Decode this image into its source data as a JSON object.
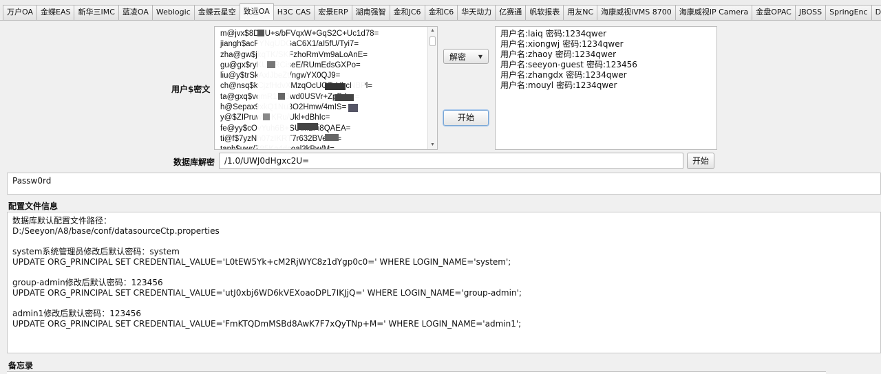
{
  "tabs": [
    {
      "label": "万户OA"
    },
    {
      "label": "金蝶EAS"
    },
    {
      "label": "新华三IMC"
    },
    {
      "label": "蓝凌OA"
    },
    {
      "label": "Weblogic"
    },
    {
      "label": "金蝶云星空"
    },
    {
      "label": "致远OA",
      "active": true
    },
    {
      "label": "H3C CAS"
    },
    {
      "label": "宏景ERP"
    },
    {
      "label": "湖南强智"
    },
    {
      "label": "金和JC6"
    },
    {
      "label": "金和C6"
    },
    {
      "label": "华天动力"
    },
    {
      "label": "亿赛通"
    },
    {
      "label": "帆软报表"
    },
    {
      "label": "用友NC"
    },
    {
      "label": "海康威视iVMS 8700"
    },
    {
      "label": "海康威视IP Camera"
    },
    {
      "label": "金盘OPAC"
    },
    {
      "label": "JBOSS"
    },
    {
      "label": "SpringEnc"
    },
    {
      "label": "Druid"
    }
  ],
  "decrypt": {
    "user_cipher_label": "用户$密文",
    "cipher_lines": [
      "m@jvx$8DNU+s/bFVqxW+GqS2C+Uc1d78=",
      "jiangh$acFYNgUDGaC6X1/aI5fU/Tyi7=",
      "zha@gw$jkqTK/SKFzhoRmVm9aLoAnE=",
      "gu@gx$ryKUmRCiseE/RUmEdsGXPo=",
      "liu@y$trSkAxlJbeZt/ngwYX0QJ9=",
      "ch@nsq$kCjzfHdvXMzqOcUGTeVLcNBPl=",
      "ta@gxq$vqmR1Ju3wd0USVr+ZpBdpk=",
      "h@Sepax9xkQ1Nu3O2Hmw/4mIS=",
      "y@$ZIPruwE1KRu/Ukl+dBhIc=",
      "fe@yy$cOvYuh6B+SUlm2Fi8QAEA=",
      "ti@f$7yzNh07zIKRT7r632BVeGx=",
      "tanh$uwr/Z85Ko4dsoal3kBw/M="
    ],
    "mode_select": "解密",
    "start_label": "开始",
    "results": [
      {
        "user": "用户名:laiq",
        "pwd": "密码:1234qwer"
      },
      {
        "user": "用户名:xiongwj",
        "pwd": "密码:1234qwer"
      },
      {
        "user": "用户名:zhaoy",
        "pwd": "密码:1234qwer"
      },
      {
        "user": "用户名:seeyon-guest",
        "pwd": "密码:123456"
      },
      {
        "user": "用户名:zhangdx",
        "pwd": "密码:1234qwer"
      },
      {
        "user": "用户名:mouyl",
        "pwd": "密码:1234qwer"
      }
    ]
  },
  "db_decrypt": {
    "label": "数据库解密",
    "input_value": "/1.0/UWJ0dHgxc2U=",
    "start_label": "开始",
    "output": "Passw0rd"
  },
  "config": {
    "title": "配置文件信息",
    "text": "数据库默认配置文件路径：\nD:/Seeyon/A8/base/conf/datasourceCtp.properties\n\nsystem系统管理员修改后默认密码：system\nUPDATE ORG_PRINCIPAL SET CREDENTIAL_VALUE='L0tEW5Yk+cM2RjWYC8z1dYgp0c0=' WHERE LOGIN_NAME='system';\n\ngroup-admin修改后默认密码：123456\nUPDATE ORG_PRINCIPAL SET CREDENTIAL_VALUE='utJ0xbj6WD6kVEXoaoDPL7IKJjQ=' WHERE LOGIN_NAME='group-admin';\n\nadmin1修改后默认密码：123456\nUPDATE ORG_PRINCIPAL SET CREDENTIAL_VALUE='FmKTQDmMSBd8AwK7F7xQyTNp+M=' WHERE LOGIN_NAME='admin1';"
  },
  "memo": {
    "title": "备忘录"
  }
}
